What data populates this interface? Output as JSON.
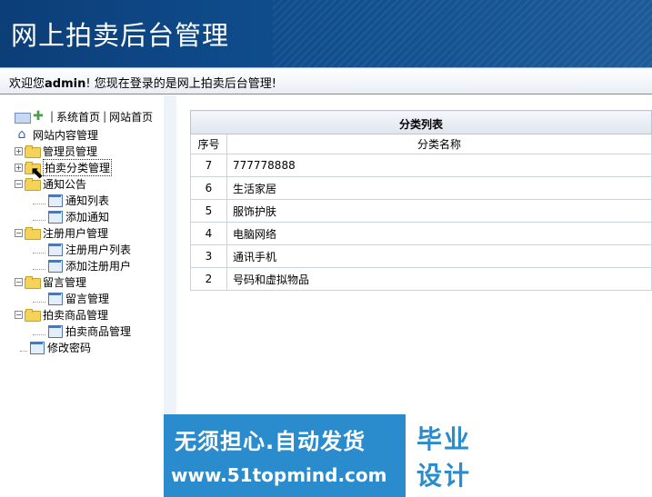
{
  "header": {
    "title": "网上拍卖后台管理"
  },
  "welcome": {
    "prefix": "欢迎您",
    "user": "admin",
    "suffix": "! 您现在登录的是网上拍卖后台管理!"
  },
  "sidebar": {
    "top_links": [
      "系统首页",
      "网站首页"
    ],
    "root": "网站内容管理",
    "groups": [
      {
        "label": "管理员管理",
        "expanded": false
      },
      {
        "label": "拍卖分类管理",
        "expanded": false
      },
      {
        "label": "通知公告",
        "expanded": true,
        "items": [
          "通知列表",
          "添加通知"
        ]
      },
      {
        "label": "注册用户管理",
        "expanded": true,
        "items": [
          "注册用户列表",
          "添加注册用户"
        ]
      },
      {
        "label": "留言管理",
        "expanded": true,
        "items": [
          "留言管理"
        ]
      },
      {
        "label": "拍卖商品管理",
        "expanded": true,
        "items": [
          "拍卖商品管理"
        ]
      }
    ],
    "tail": "修改密码"
  },
  "table": {
    "caption": "分类列表",
    "headers": [
      "序号",
      "分类名称"
    ],
    "rows": [
      [
        "7",
        "777778888"
      ],
      [
        "6",
        "生活家居"
      ],
      [
        "5",
        "服饰护肤"
      ],
      [
        "4",
        "电脑网络"
      ],
      [
        "3",
        "通讯手机"
      ],
      [
        "2",
        "号码和虚拟物品"
      ]
    ]
  },
  "banner": {
    "line1": "无须担心.自动发货",
    "line2": "www.51topmind.com",
    "badge1": "毕业",
    "badge2": "设计"
  }
}
